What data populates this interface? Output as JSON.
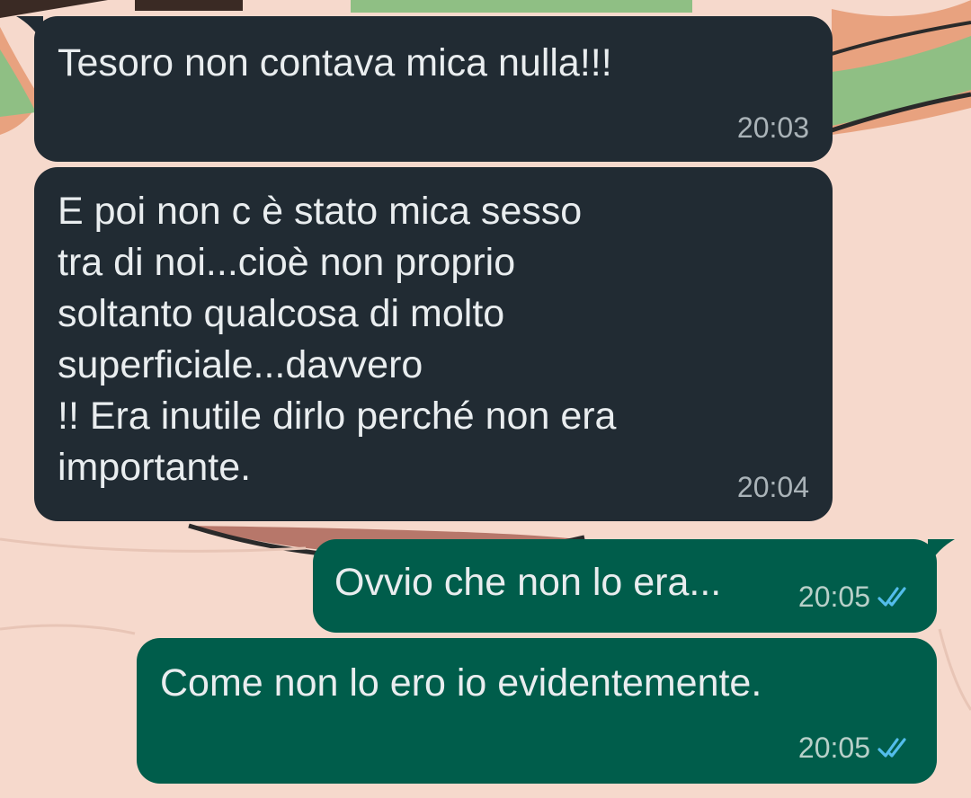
{
  "colors": {
    "incoming_bubble": "#212b33",
    "outgoing_bubble": "#005d4b",
    "message_text": "#e9edef",
    "timestamp": "#aab3b8",
    "read_ticks": "#53bdeb",
    "wallpaper": "#f6d9cc"
  },
  "messages": [
    {
      "direction": "incoming",
      "text": "Tesoro non contava mica nulla!!!",
      "time": "20:03"
    },
    {
      "direction": "incoming",
      "text": "E poi non c è stato mica sesso\ntra di noi...cioè non proprio\nsoltanto qualcosa di molto\nsuperficiale...davvero\n!! Era inutile dirlo perché non era\nimportante.",
      "time": "20:04"
    },
    {
      "direction": "outgoing",
      "text": "Ovvio che non lo era...",
      "time": "20:05",
      "status_icon": "double-check-read-icon"
    },
    {
      "direction": "outgoing",
      "text": "Come non lo ero io evidentemente.",
      "time": "20:05",
      "status_icon": "double-check-read-icon"
    }
  ]
}
